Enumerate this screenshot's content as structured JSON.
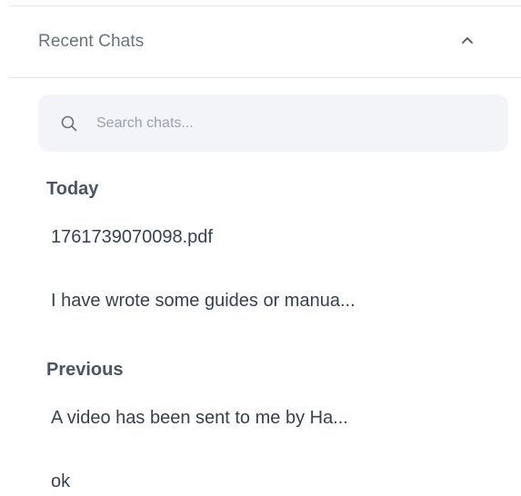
{
  "recent_chats": {
    "title": "Recent Chats",
    "toggle_icon": "chevron-up-icon"
  },
  "search": {
    "placeholder": "Search chats...",
    "value": "",
    "icon": "search-icon"
  },
  "groups": [
    {
      "label": "Today",
      "items": [
        {
          "label": "1761739070098.pdf"
        },
        {
          "label": "I have wrote some guides or manua..."
        }
      ]
    },
    {
      "label": "Previous",
      "items": [
        {
          "label": "A video has been sent to me by Ha..."
        },
        {
          "label": "ok"
        }
      ]
    }
  ],
  "colors": {
    "text_primary": "#374151",
    "text_muted": "#6b7280",
    "search_bg": "#f2f4f8",
    "divider": "#e6e8ee"
  }
}
